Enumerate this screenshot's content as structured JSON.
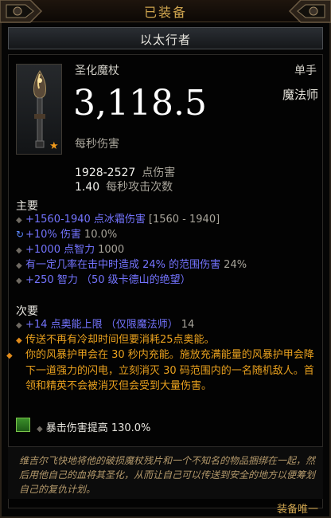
{
  "header": {
    "title": "已装备"
  },
  "item": {
    "name": "以太行者",
    "type": "圣化魔杖",
    "slot": "单手",
    "class": "魔法师",
    "dps": "3,118.5",
    "dps_label": "每秒伤害",
    "damage_range": "1928-2527",
    "damage_label": "点伤害",
    "attack_speed": "1.40",
    "attack_speed_label": "每秒攻击次数"
  },
  "primary": {
    "title": "主要",
    "affixes": [
      {
        "text": "+1560-1940 点冰霜伤害",
        "range": "[1560 - 1940]",
        "bullet": "diamond"
      },
      {
        "text": "+10% 伤害",
        "range": "10.0%",
        "bullet": "reroll"
      },
      {
        "text": "+1000 点智力",
        "range": "1000",
        "bullet": "diamond"
      },
      {
        "text": "有一定几率在击中时造成 24% 的范围伤害",
        "range": "24%",
        "bullet": "diamond"
      },
      {
        "text": "+250 智力 （50 级卡德山的绝望）",
        "range": "",
        "bullet": "diamond"
      }
    ]
  },
  "secondary": {
    "title": "次要",
    "affixes": [
      {
        "text": "+14 点奥能上限 （仅限魔法师）",
        "range": "14",
        "bullet": "diamond"
      },
      {
        "text": "传送不再有冷却时间但要消耗25点奥能。",
        "range": "",
        "bullet": "orange"
      },
      {
        "text": "你的风暴护甲会在 30 秒内充能。施放充满能量的风暴护甲会降下一道强力的闪电，立刻消灭 30 码范围内的一名随机敌人。首领和精英不会被消灭但会受到大量伤害。",
        "range": "",
        "bullet": "orange"
      }
    ]
  },
  "gem": {
    "text": "暴击伤害提高 130.0%"
  },
  "flavor": "维吉尔飞快地将他的破损魔杖残片和一个不知名的物品捆绑在一起，然后用他自己的血将其圣化，从而让自己可以传送到安全的地方以便筹划自己的复仇计划。",
  "account_bound": "装备唯一",
  "colors": {
    "legendary": "#e8a01e",
    "magic": "#7474ff",
    "gold": "#cfa54f"
  },
  "icons": {
    "star": "star-icon",
    "weapon": "wand-icon"
  }
}
